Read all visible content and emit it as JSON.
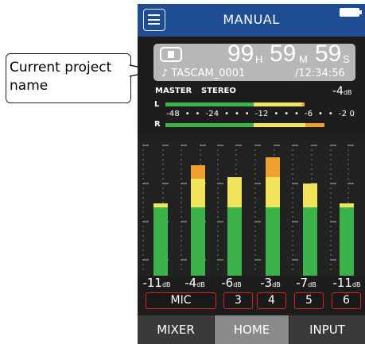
{
  "callout": {
    "text_line1": "Current project",
    "text_line2": "name"
  },
  "topbar": {
    "mode_title": "MANUAL",
    "menu_icon": "hamburger-menu-icon",
    "battery_icon": "battery-icon"
  },
  "status": {
    "stop_icon": "stop-icon",
    "hours": "99",
    "hours_unit": "H",
    "minutes": "59",
    "minutes_unit": "M",
    "seconds": "59",
    "seconds_unit": "S",
    "project_name": "♪ TASCAM_0001",
    "remaining_time": "/12:34:56"
  },
  "master": {
    "label": "MASTER",
    "mode": "STEREO",
    "level_value": "-4",
    "level_unit": "dB",
    "left_label": "L",
    "right_label": "R",
    "scale": "-48  •  •  -24  •  •  •  -12  •  •  •  -6  •  •  -2 0",
    "left_fill_percent": 90,
    "right_fill_percent": 96
  },
  "channels": [
    {
      "level": "-11",
      "unit": "dB",
      "green": 55,
      "yellow": 3,
      "orange": 0
    },
    {
      "level": "-4",
      "unit": "dB",
      "green": 55,
      "yellow": 23,
      "orange": 11
    },
    {
      "level": "-6",
      "unit": "dB",
      "green": 55,
      "yellow": 24,
      "orange": 0
    },
    {
      "level": "-3",
      "unit": "dB",
      "green": 55,
      "yellow": 24,
      "orange": 16
    },
    {
      "level": "-7",
      "unit": "dB",
      "green": 55,
      "yellow": 19,
      "orange": 0
    },
    {
      "level": "-11",
      "unit": "dB",
      "green": 55,
      "yellow": 3,
      "orange": 0
    }
  ],
  "inputs": [
    "MIC",
    "3",
    "4",
    "5",
    "6"
  ],
  "tabs": [
    {
      "label": "MIXER",
      "active": false
    },
    {
      "label": "HOME",
      "active": true
    },
    {
      "label": "INPUT",
      "active": false
    }
  ],
  "colors": {
    "blue": "#1e4d93",
    "green": "#3cb34a",
    "yellow": "#f1e45a",
    "orange": "#f0a030",
    "red": "#e02020"
  }
}
